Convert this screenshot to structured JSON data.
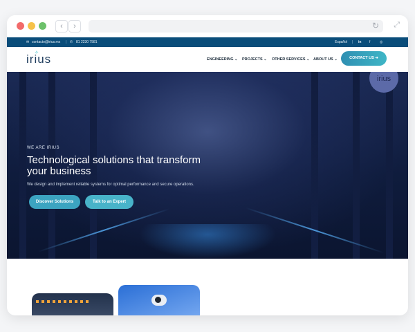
{
  "browser": {
    "back_icon": "‹",
    "forward_icon": "›",
    "reload_icon": "↻",
    "expand_icon": "⤢"
  },
  "topbar": {
    "email": "contacto@irius.mx",
    "phone": "81 2230 7581",
    "language": "Español",
    "social": [
      "in",
      "f",
      "◎"
    ]
  },
  "header": {
    "logo_text": "irius",
    "menu": [
      "ENGINEERING ⌄",
      "PROJECTS ⌄",
      "OTHER SERVICES ⌄",
      "ABOUT US ⌄"
    ],
    "contact_label": "CONTACT US ➜"
  },
  "hero": {
    "badge_text": "irius",
    "eyebrow": "WE ARE IRIUS",
    "title": "Technological solutions that transform your business",
    "subtitle": "We design and implement reliable systems for optimal performance and secure operations.",
    "primary_button": "Discover Solutions",
    "secondary_button": "Talk to an Expert"
  },
  "colors": {
    "topbar": "#0a4d7a",
    "accent": "#3fb6c6",
    "hero_dark": "#0f1c3d"
  }
}
